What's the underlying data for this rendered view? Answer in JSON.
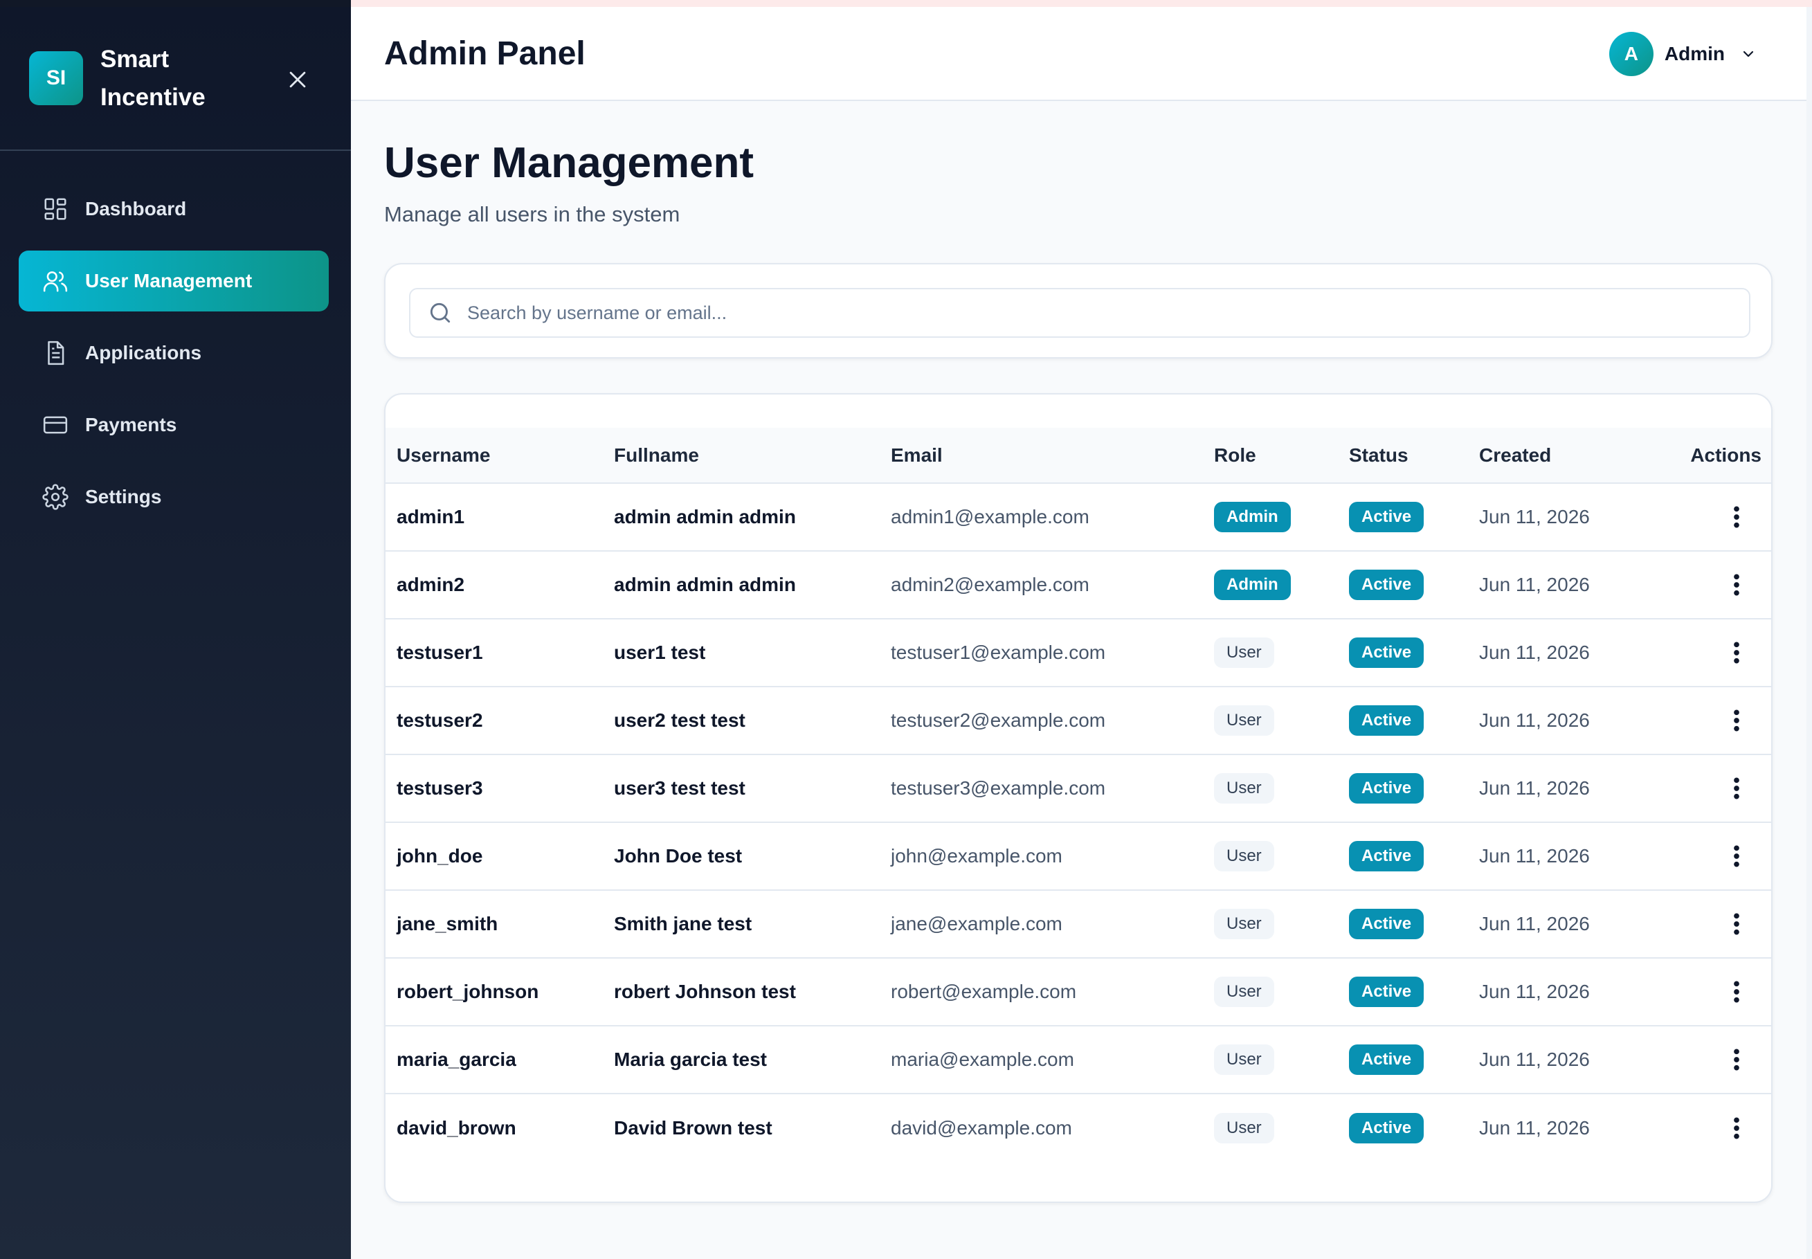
{
  "app": {
    "logo_text": "SI",
    "name": "Smart Incentive"
  },
  "sidebar": {
    "items": [
      {
        "label": "Dashboard",
        "icon": "dashboard-icon",
        "active": false
      },
      {
        "label": "User Management",
        "icon": "users-icon",
        "active": true
      },
      {
        "label": "Applications",
        "icon": "document-icon",
        "active": false
      },
      {
        "label": "Payments",
        "icon": "credit-card-icon",
        "active": false
      },
      {
        "label": "Settings",
        "icon": "gear-icon",
        "active": false
      }
    ]
  },
  "header": {
    "title": "Admin Panel",
    "user": {
      "avatar_letter": "A",
      "name": "Admin"
    }
  },
  "page": {
    "title": "User Management",
    "subtitle": "Manage all users in the system"
  },
  "search": {
    "placeholder": "Search by username or email..."
  },
  "table": {
    "columns": [
      "Username",
      "Fullname",
      "Email",
      "Role",
      "Status",
      "Created",
      "Actions"
    ],
    "rows": [
      {
        "username": "admin1",
        "fullname": "admin admin admin",
        "email": "admin1@example.com",
        "role": "Admin",
        "status": "Active",
        "created": "Jun 11, 2026"
      },
      {
        "username": "admin2",
        "fullname": "admin admin admin",
        "email": "admin2@example.com",
        "role": "Admin",
        "status": "Active",
        "created": "Jun 11, 2026"
      },
      {
        "username": "testuser1",
        "fullname": "user1 test",
        "email": "testuser1@example.com",
        "role": "User",
        "status": "Active",
        "created": "Jun 11, 2026"
      },
      {
        "username": "testuser2",
        "fullname": "user2 test test",
        "email": "testuser2@example.com",
        "role": "User",
        "status": "Active",
        "created": "Jun 11, 2026"
      },
      {
        "username": "testuser3",
        "fullname": "user3 test test",
        "email": "testuser3@example.com",
        "role": "User",
        "status": "Active",
        "created": "Jun 11, 2026"
      },
      {
        "username": "john_doe",
        "fullname": "John Doe test",
        "email": "john@example.com",
        "role": "User",
        "status": "Active",
        "created": "Jun 11, 2026"
      },
      {
        "username": "jane_smith",
        "fullname": "Smith jane test",
        "email": "jane@example.com",
        "role": "User",
        "status": "Active",
        "created": "Jun 11, 2026"
      },
      {
        "username": "robert_johnson",
        "fullname": "robert Johnson test",
        "email": "robert@example.com",
        "role": "User",
        "status": "Active",
        "created": "Jun 11, 2026"
      },
      {
        "username": "maria_garcia",
        "fullname": "Maria garcia test",
        "email": "maria@example.com",
        "role": "User",
        "status": "Active",
        "created": "Jun 11, 2026"
      },
      {
        "username": "david_brown",
        "fullname": "David Brown test",
        "email": "david@example.com",
        "role": "User",
        "status": "Active",
        "created": "Jun 11, 2026"
      }
    ]
  },
  "colors": {
    "accent": "#0891b2",
    "accent_gradient_end": "#0d9488",
    "sidebar_bg": "#0f172a"
  }
}
